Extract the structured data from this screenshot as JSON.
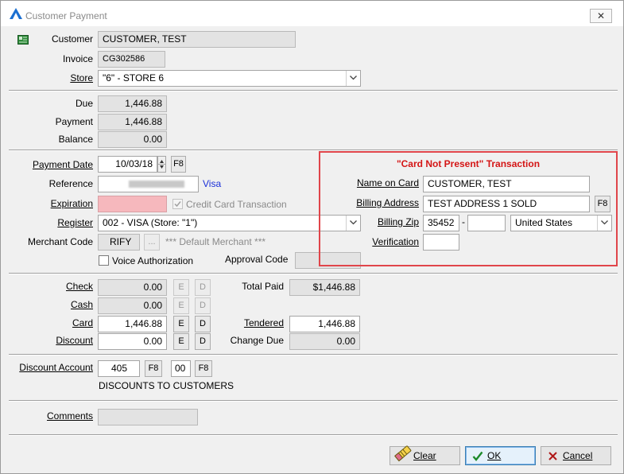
{
  "window": {
    "title": "Customer Payment",
    "close_label": "✕"
  },
  "customer": {
    "customer_label": "Customer",
    "customer_value": "CUSTOMER, TEST",
    "invoice_label": "Invoice",
    "invoice_value": "CG302586",
    "store_label": "Store",
    "store_value": "\"6\" - STORE 6"
  },
  "totals": {
    "due_label": "Due",
    "due_value": "1,446.88",
    "payment_label": "Payment",
    "payment_value": "1,446.88",
    "balance_label": "Balance",
    "balance_value": "0.00"
  },
  "payment": {
    "date_label": "Payment Date",
    "date_value": "10/03/18",
    "date_f8": "F8",
    "reference_label": "Reference",
    "reference_value": "",
    "reference_card_type": "Visa",
    "expiration_label": "Expiration",
    "credit_card_label": "Credit Card Transaction",
    "register_label": "Register",
    "register_value": "002 - VISA (Store: \"1\")",
    "merchant_label": "Merchant Code",
    "merchant_value": "RIFY",
    "merchant_browse": "...",
    "merchant_default": "*** Default Merchant ***",
    "voice_label": "Voice Authorization",
    "approval_label": "Approval Code",
    "approval_value": ""
  },
  "cnp": {
    "header": "\"Card Not Present\" Transaction",
    "name_label": "Name on Card",
    "name_value": "CUSTOMER, TEST",
    "address_label": "Billing Address",
    "address_value": "TEST ADDRESS 1 SOLD",
    "address_f8": "F8",
    "zip_label": "Billing Zip",
    "zip_value": "35452",
    "zip_dash": "-",
    "zip_ext": "",
    "country_value": "United States",
    "verification_label": "Verification",
    "verification_value": ""
  },
  "tenders": {
    "check_label": "Check",
    "check_value": "0.00",
    "cash_label": "Cash",
    "cash_value": "0.00",
    "card_label": "Card",
    "card_value": "1,446.88",
    "discount_label": "Discount",
    "discount_value": "0.00",
    "e_label": "E",
    "d_label": "D",
    "total_paid_label": "Total Paid",
    "total_paid_value": "$1,446.88",
    "tendered_label": "Tendered",
    "tendered_value": "1,446.88",
    "change_label": "Change Due",
    "change_value": "0.00"
  },
  "discount_account": {
    "label": "Discount Account",
    "account": "405",
    "f8a": "F8",
    "sub": "00",
    "f8b": "F8",
    "description": "DISCOUNTS TO CUSTOMERS"
  },
  "comments": {
    "label": "Comments",
    "value": ""
  },
  "buttons": {
    "clear": "Clear",
    "ok": "OK",
    "cancel": "Cancel"
  },
  "colors": {
    "accent_red": "#e0454a",
    "header_red": "#d41515",
    "link_blue": "#1a2fd8"
  }
}
